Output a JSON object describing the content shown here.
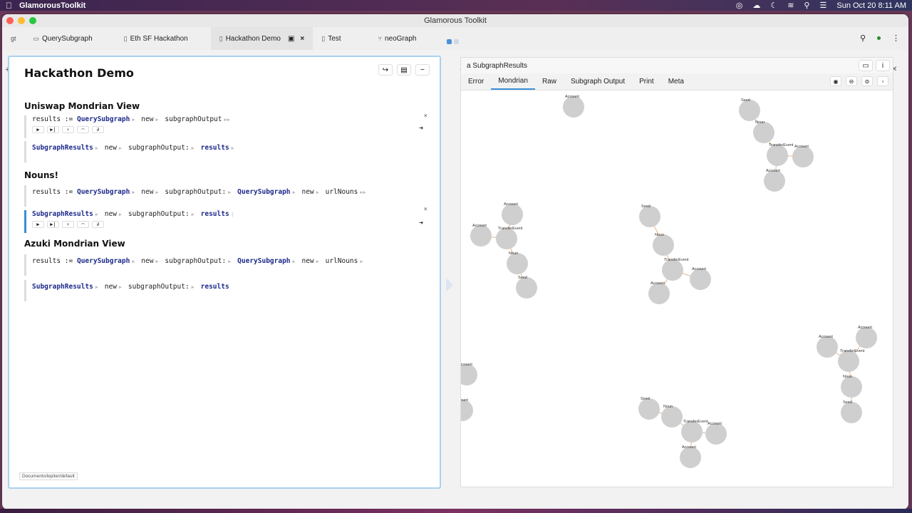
{
  "menubar": {
    "app_name": "GlamorousToolkit",
    "datetime": "Sun Oct 20  8:11 AM"
  },
  "window": {
    "title": "Glamorous Toolkit"
  },
  "tabs": [
    {
      "label": "QuerySubgraph",
      "icon": "book-icon"
    },
    {
      "label": "Eth SF Hackathon",
      "icon": "page-icon"
    },
    {
      "label": "Hackathon Demo",
      "icon": "page-icon",
      "active": true
    },
    {
      "label": "Test",
      "icon": "page-icon"
    },
    {
      "label": "neoGraph",
      "icon": "branch-icon"
    }
  ],
  "left": {
    "title": "Hackathon Demo",
    "footer": "Documents/lepiter/default",
    "sections": {
      "s1": "Uniswap Mondrian View",
      "s2": "Nouns!",
      "s3": "Azuki Mondrian View"
    },
    "code": {
      "results": "results",
      "assign": ":=",
      "query_subgraph": "QuerySubgraph",
      "new": "new",
      "subgraph_output": "subgraphOutput",
      "subgraph_output_kw": "subgraphOutput:",
      "subgraph_results": "SubgraphResults",
      "url_nouns": "urlNouns"
    }
  },
  "right": {
    "title": "a SubgraphResults",
    "tabs": [
      "Error",
      "Mondrian",
      "Raw",
      "Subgraph Output",
      "Print",
      "Meta"
    ],
    "active_tab": "Mondrian",
    "node_labels": {
      "account": "Account",
      "seed": "Seed",
      "noun": "Noun",
      "transfer": "TransferEvent"
    }
  },
  "colors": {
    "accent": "#3b8fd9",
    "node": "#cfcfcf",
    "edge": "#e8b48a"
  }
}
